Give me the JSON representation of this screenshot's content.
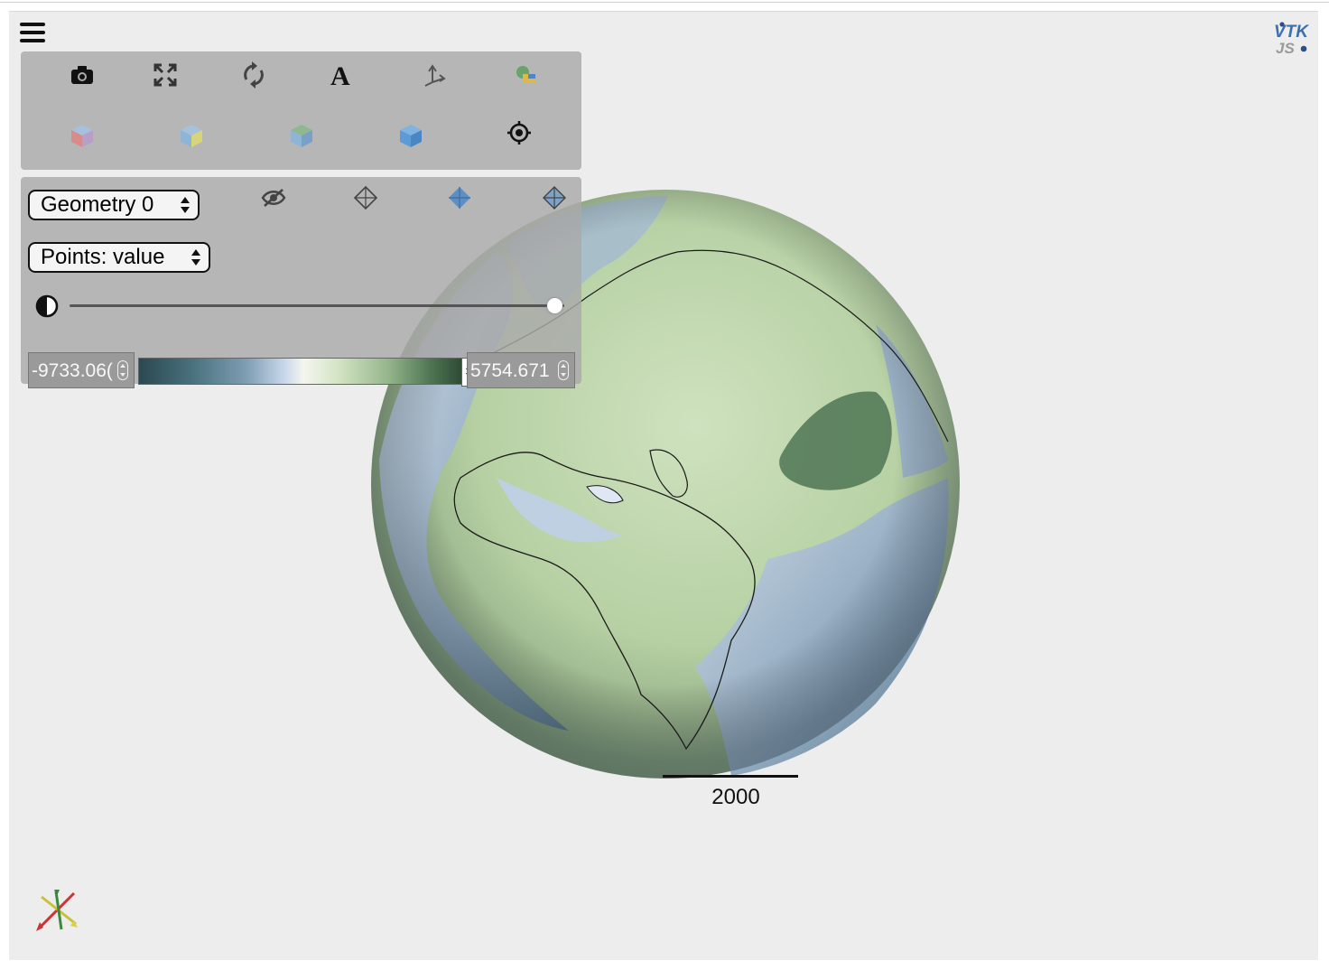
{
  "toolbar": {
    "buttons": [
      {
        "name": "screenshot-icon"
      },
      {
        "name": "fullscreen-icon"
      },
      {
        "name": "reset-camera-icon"
      },
      {
        "name": "text-annotation-icon",
        "glyph": "A"
      },
      {
        "name": "axes-orientation-icon"
      },
      {
        "name": "color-layers-icon"
      }
    ],
    "views": [
      {
        "name": "view-x-icon",
        "color": "#d98a8a"
      },
      {
        "name": "view-y-icon",
        "color": "#d8d47a"
      },
      {
        "name": "view-z-icon",
        "color": "#8fb88f"
      },
      {
        "name": "view-iso-icon",
        "color": "#5b9bd8"
      },
      {
        "name": "center-target-icon"
      }
    ]
  },
  "controls": {
    "geometry_select": "Geometry 0",
    "representation_icons": [
      "visibility-off-icon",
      "points-icon",
      "surface-icon",
      "wireframe-icon"
    ],
    "color_by_select": "Points: value",
    "opacity": 1.0,
    "range_min": "-9733.06(",
    "range_max": "5754.671",
    "colormap": [
      "#2b4850",
      "#48707c",
      "#7d9db2",
      "#c9d7ec",
      "#f4f6ee",
      "#d2e3c3",
      "#96b68d",
      "#4f7654",
      "#2e4a32"
    ]
  },
  "scale": {
    "label": "2000"
  },
  "colors": {
    "background": "#ededed",
    "panel": "#aaaaaa",
    "land": "#b9d3a8",
    "ocean": "#8da8be"
  }
}
